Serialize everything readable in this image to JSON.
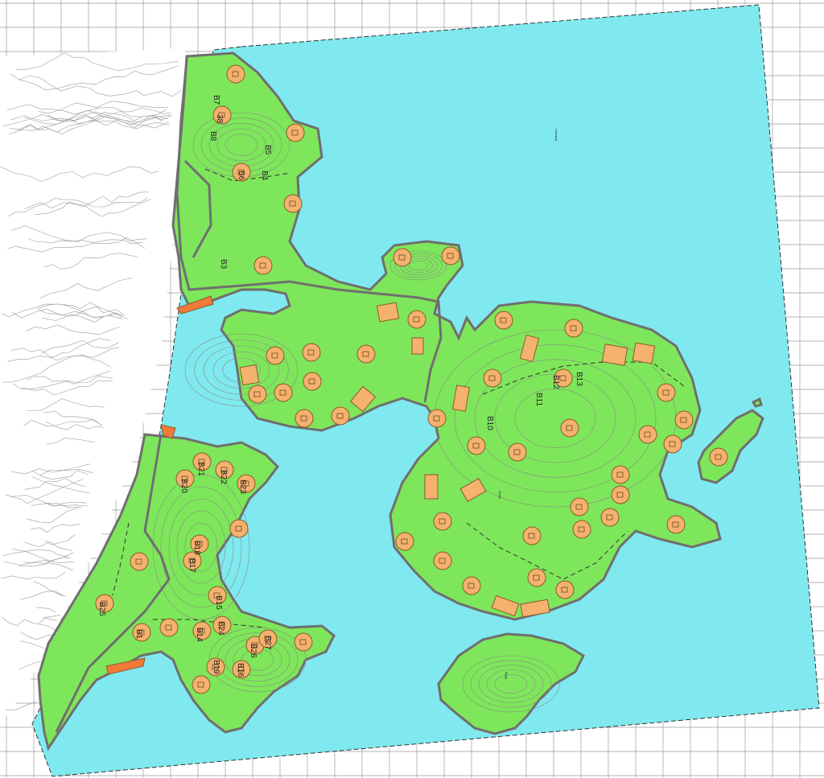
{
  "map": {
    "colors": {
      "background": "#ffffff",
      "grid": "#9a9a9a",
      "water": "#7fe9ef",
      "land": "#7ee65a",
      "land_outline": "#6f6f6f",
      "contour": "#8a8a8a",
      "terrain_lines": "#9b9b9b",
      "plot_fill": "#f5b26f",
      "plot_stroke": "#8a5a2a",
      "accent_orange": "#f07a3a"
    },
    "plot_labels": [
      "B7",
      "38",
      "B8",
      "B5",
      "B6",
      "B4",
      "B3",
      "B21",
      "B22",
      "B20",
      "B23",
      "B18",
      "B17",
      "B15",
      "B25",
      "B1",
      "B14",
      "B24",
      "B27",
      "B26",
      "B19",
      "B16",
      "B12",
      "B13",
      "B11",
      "B10"
    ],
    "small_text": [
      "Kartdata",
      "Skala",
      "Bygg"
    ]
  }
}
